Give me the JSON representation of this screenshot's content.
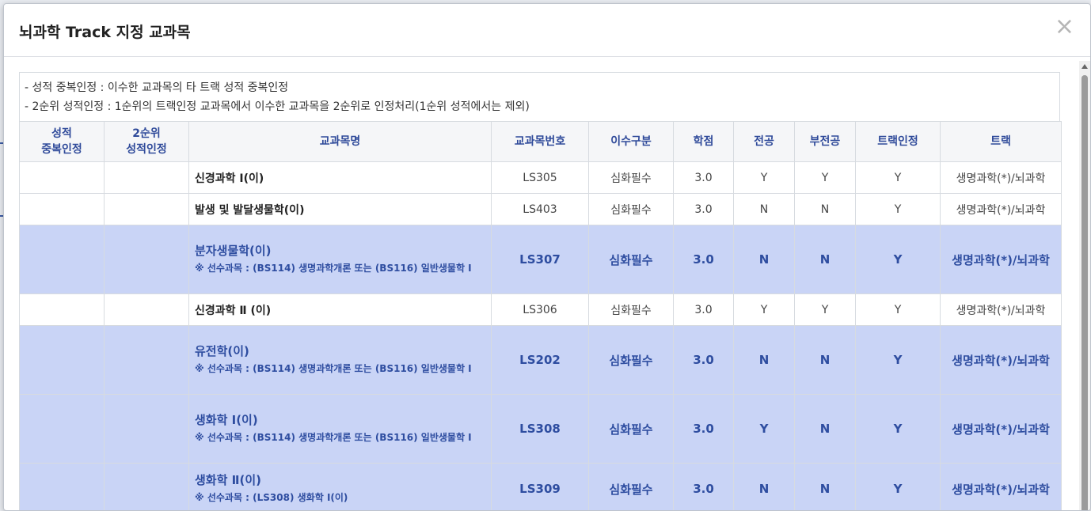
{
  "modal": {
    "title": "뇌과학 Track 지정 교과목",
    "close_glyph": "×"
  },
  "notes": [
    "- 성적 중복인정 : 이수한 교과목의 타 트랙 성적 중복인정",
    "- 2순위 성적인정 : 1순위의 트랙인정 교과목에서 이수한 교과목을 2순위로 인정처리(1순위 성적에서는 제외)"
  ],
  "table": {
    "headers": {
      "dup_line1": "성적",
      "dup_line2": "중복인정",
      "second_line1": "2순위",
      "second_line2": "성적인정",
      "name": "교과목명",
      "code": "교과목번호",
      "category": "이수구분",
      "credit": "학점",
      "major": "전공",
      "minor": "부전공",
      "track_recog": "트랙인정",
      "track": "트랙"
    },
    "rows": [
      {
        "name": "신경과학 Ⅰ(이)",
        "prereq": "",
        "code": "LS305",
        "category": "심화필수",
        "credit": "3.0",
        "major": "Y",
        "minor": "Y",
        "track_recog": "Y",
        "track": "생명과학(*)/뇌과학"
      },
      {
        "name": "발생 및 발달생물학(이)",
        "prereq": "",
        "code": "LS403",
        "category": "심화필수",
        "credit": "3.0",
        "major": "N",
        "minor": "N",
        "track_recog": "Y",
        "track": "생명과학(*)/뇌과학"
      },
      {
        "name": "분자생물학(이)",
        "prereq": "※ 선수과목 : (BS114) 생명과학개론 또는 (BS116) 일반생물학 Ⅰ",
        "code": "LS307",
        "category": "심화필수",
        "credit": "3.0",
        "major": "N",
        "minor": "N",
        "track_recog": "Y",
        "track": "생명과학(*)/뇌과학"
      },
      {
        "name": "신경과학 Ⅱ (이)",
        "prereq": "",
        "code": "LS306",
        "category": "심화필수",
        "credit": "3.0",
        "major": "Y",
        "minor": "Y",
        "track_recog": "Y",
        "track": "생명과학(*)/뇌과학"
      },
      {
        "name": "유전학(이)",
        "prereq": "※ 선수과목 : (BS114) 생명과학개론 또는 (BS116) 일반생물학 Ⅰ",
        "code": "LS202",
        "category": "심화필수",
        "credit": "3.0",
        "major": "N",
        "minor": "N",
        "track_recog": "Y",
        "track": "생명과학(*)/뇌과학"
      },
      {
        "name": "생화학 Ⅰ(이)",
        "prereq": "※ 선수과목 : (BS114) 생명과학개론 또는 (BS116) 일반생물학 Ⅰ",
        "code": "LS308",
        "category": "심화필수",
        "credit": "3.0",
        "major": "Y",
        "minor": "N",
        "track_recog": "Y",
        "track": "생명과학(*)/뇌과학"
      },
      {
        "name": "생화학 Ⅱ(이)",
        "prereq": "※ 선수과목 : (LS308) 생화학 Ⅰ(이)",
        "code": "LS309",
        "category": "심화필수",
        "credit": "3.0",
        "major": "N",
        "minor": "N",
        "track_recog": "Y",
        "track": "생명과학(*)/뇌과학"
      }
    ]
  }
}
